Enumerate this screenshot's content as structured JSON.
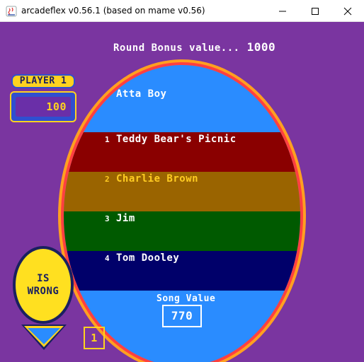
{
  "window": {
    "title": "arcadeflex v0.56.1 (based on mame v0.56)",
    "controls": [
      "minimize-icon",
      "maximize-icon",
      "close-icon"
    ]
  },
  "game": {
    "round_bonus_label": "Round Bonus value...",
    "round_bonus_value": "1000",
    "player": {
      "label": "PLAYER 1",
      "score": "100"
    },
    "question": "Atta Boy",
    "choices": [
      {
        "number": "1",
        "text": "Teddy Bear's Picnic"
      },
      {
        "number": "2",
        "text": "Charlie Brown"
      },
      {
        "number": "3",
        "text": "Jim"
      },
      {
        "number": "4",
        "text": "Tom Dooley"
      }
    ],
    "song_value_label": "Song Value",
    "song_value": "770",
    "status_line1": "IS",
    "status_line2": "WRONG",
    "small_box": "1",
    "colors": {
      "background": "#7a35a0",
      "oval_blue": "#2a8cff",
      "band_red": "#8a0000",
      "band_gold": "#9a6400",
      "band_green": "#005a00",
      "band_navy": "#00006a",
      "yellow": "#ffd21f"
    }
  }
}
